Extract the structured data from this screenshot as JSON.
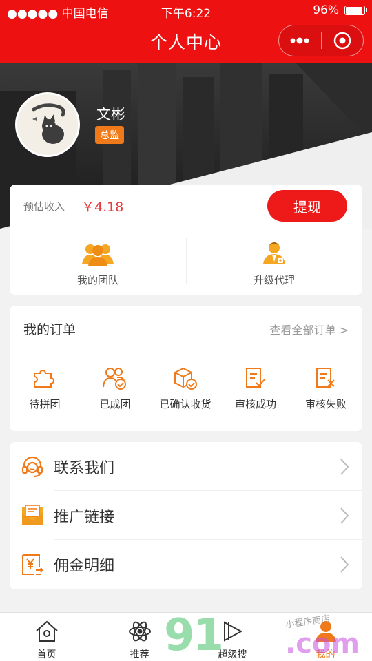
{
  "status_bar": {
    "carrier": "●●●●● 中国电信",
    "time": "下午6:22",
    "battery": "96%",
    "battery_level": 0.96
  },
  "nav": {
    "title": "个人中心",
    "more_icon": "more-dots-icon",
    "close_icon": "target-icon"
  },
  "profile": {
    "name": "文彬",
    "role": "总监",
    "avatar_icon": "cat-avatar-icon"
  },
  "earnings": {
    "label": "预估收入",
    "amount": "￥4.18",
    "withdraw_label": "提现",
    "shortcuts": [
      {
        "label": "我的团队",
        "icon": "team-icon"
      },
      {
        "label": "升级代理",
        "icon": "agent-icon"
      }
    ]
  },
  "orders": {
    "title": "我的订单",
    "view_all": "查看全部订单 >",
    "statuses": [
      {
        "label": "待拼团",
        "icon": "puzzle-icon"
      },
      {
        "label": "已成团",
        "icon": "group-check-icon"
      },
      {
        "label": "已确认收货",
        "icon": "box-check-icon"
      },
      {
        "label": "审核成功",
        "icon": "doc-check-icon"
      },
      {
        "label": "审核失败",
        "icon": "doc-x-icon"
      }
    ]
  },
  "menu": [
    {
      "label": "联系我们",
      "icon": "headset-icon"
    },
    {
      "label": "推广链接",
      "icon": "mail-icon"
    },
    {
      "label": "佣金明细",
      "icon": "yuan-doc-icon"
    }
  ],
  "tabs": [
    {
      "label": "首页",
      "icon": "home-icon"
    },
    {
      "label": "推荐",
      "icon": "atom-icon"
    },
    {
      "label": "超级搜",
      "icon": "play-icon"
    },
    {
      "label": "我的",
      "icon": "user-icon"
    }
  ],
  "watermark": {
    "main": "91",
    "domain": ".com",
    "small": "小程序商店"
  },
  "colors": {
    "primary": "#ee1111",
    "accent": "#f07a1a",
    "amount": "#e73c3c"
  }
}
